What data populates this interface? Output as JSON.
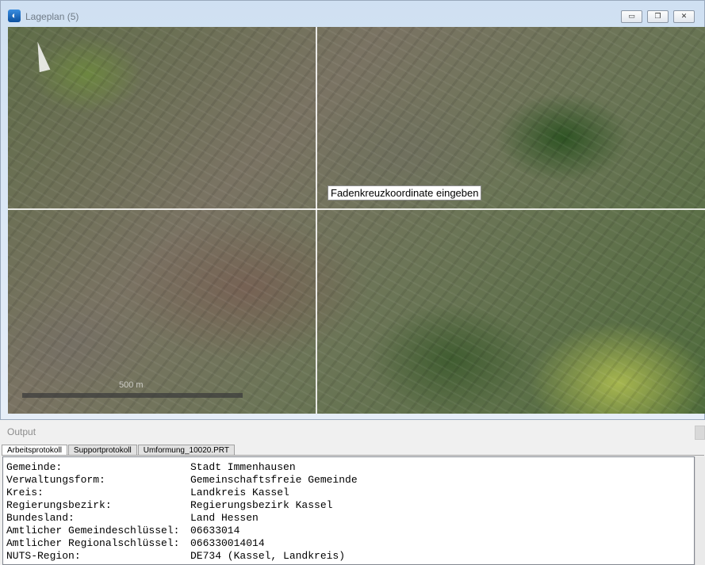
{
  "window": {
    "title": "Lageplan (5)",
    "app_icon": "compass-app-icon",
    "buttons": {
      "minimize_symbol": "▭",
      "maximize_symbol": "❐",
      "close_symbol": "✕"
    }
  },
  "map": {
    "crosshair_tooltip": "Fadenkreuzkoordinate eingeben",
    "scale_label": "500 m"
  },
  "output": {
    "title": "Output",
    "tabs": [
      {
        "label": "Arbeitsprotokoll",
        "active": true
      },
      {
        "label": "Supportprotokoll",
        "active": false
      },
      {
        "label": "Umformung_10020.PRT",
        "active": false
      }
    ],
    "rows": [
      {
        "key": "Gemeinde:",
        "value": "Stadt Immenhausen"
      },
      {
        "key": "Verwaltungsform:",
        "value": "Gemeinschaftsfreie Gemeinde"
      },
      {
        "key": "Kreis:",
        "value": "Landkreis Kassel"
      },
      {
        "key": "Regierungsbezirk:",
        "value": "Regierungsbezirk Kassel"
      },
      {
        "key": "Bundesland:",
        "value": "Land Hessen"
      },
      {
        "key": "Amtlicher Gemeindeschlüssel:",
        "value": "06633014"
      },
      {
        "key": "Amtlicher Regionalschlüssel:",
        "value": "066330014014"
      },
      {
        "key": "NUTS-Region:",
        "value": "DE734 (Kassel, Landkreis)"
      }
    ]
  }
}
